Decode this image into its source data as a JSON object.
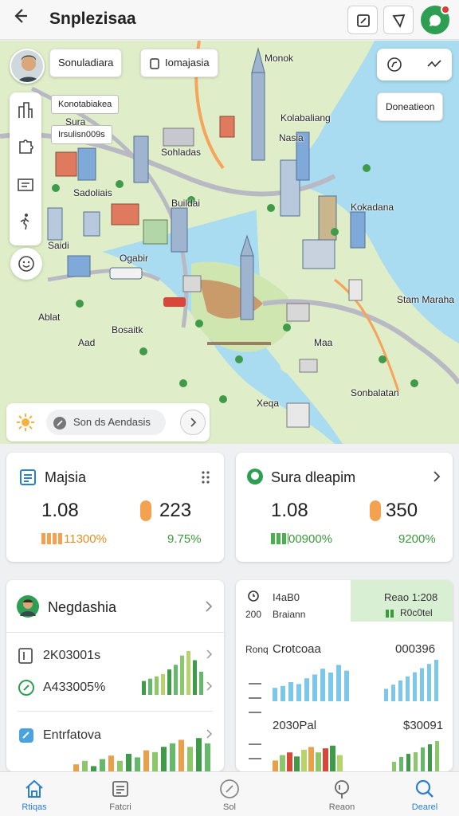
{
  "header": {
    "title": "Snplezisaa",
    "back_icon": "arrow-left-icon"
  },
  "map": {
    "chips": {
      "top_left": "Sonuladiara",
      "top_mid": "Iomajasia",
      "right": "Doneatieon"
    },
    "tags": {
      "a": "Konotabiakea",
      "b": "Irsulisn009s"
    },
    "labels": {
      "monok": "Monok",
      "sura": "Sura",
      "kolabaliang": "Kolabaliang",
      "nasia": "Nasia",
      "sohlada": "Sohladas",
      "kokadana": "Kokadana",
      "saidi": "Saidi",
      "sadoliais": "Sadoliais",
      "ogabir": "Ogabir",
      "buildai": "Buildai",
      "ablat": "Ablat",
      "aad": "Aad",
      "bosaitk": "Bosaitk",
      "maa": "Maa",
      "stammi": "Stam Maraha",
      "sonbalatan": "Sonbalatan",
      "xeqa": "Xeqa"
    },
    "search": {
      "placeholder": "Son ds Aendasis",
      "go_icon": "chevron-right-icon"
    }
  },
  "cards": {
    "majsia": {
      "title": "Majsia",
      "stat1": "1.08",
      "stat2": "223",
      "pct1": "11300%",
      "pct2": "9.75%"
    },
    "sura": {
      "title": "Sura dleapim",
      "stat1": "1.08",
      "stat2": "350",
      "pct1": "00900%",
      "pct2": "9200%"
    },
    "negda": {
      "title": "Negdashia",
      "row1": "2K03001s",
      "row2": "A433005%",
      "row3": "Entrfatova"
    },
    "right": {
      "head1": "I4aB0",
      "head2": "Braiann",
      "head0": "200",
      "badge1": "Reao 1:208",
      "badge2": "R0c0tel",
      "row1_left": "Ronq",
      "row1_mid": "Crotcoaa",
      "row1_right": "000396",
      "row2_left": "2030Pal",
      "row2_right": "$30091"
    }
  },
  "nav": {
    "items": [
      {
        "label": "Rtiqas",
        "icon": "home-icon"
      },
      {
        "label": "Fatcri",
        "icon": "list-icon"
      },
      {
        "label": "Sol",
        "icon": "compass-icon"
      },
      {
        "label": "Reaon",
        "icon": "pin-icon"
      },
      {
        "label": "Dearel",
        "icon": "search-icon"
      }
    ]
  },
  "colors": {
    "accent": "#2a7fd0",
    "positive": "#3a9b3a",
    "warning": "#e88f22",
    "water": "#a9dcf0",
    "land": "#dfeec8"
  }
}
